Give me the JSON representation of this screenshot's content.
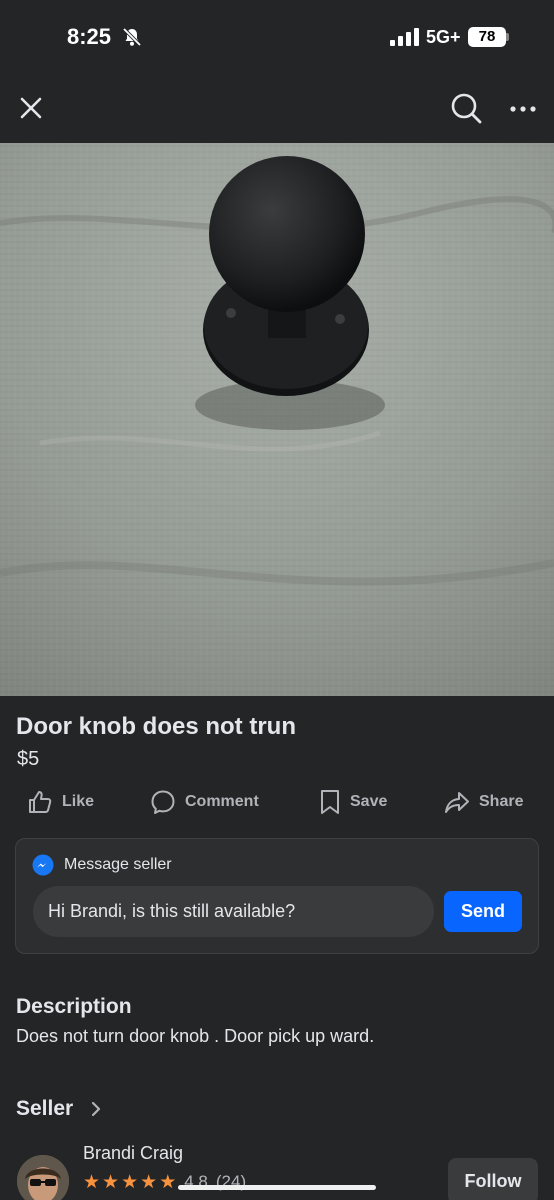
{
  "status_bar": {
    "time": "8:25",
    "network": "5G+",
    "battery": "78"
  },
  "nav": {
    "close_icon": "close-icon",
    "search_icon": "search-icon",
    "more_icon": "more-icon"
  },
  "listing": {
    "title": "Door knob does not trun",
    "price": "$5",
    "photo_subject": "black door knob on grey fabric"
  },
  "actions": {
    "like": "Like",
    "comment": "Comment",
    "save": "Save",
    "share": "Share"
  },
  "message": {
    "header": "Message seller",
    "input_value": "Hi Brandi, is this still available?",
    "send": "Send"
  },
  "description": {
    "heading": "Description",
    "text": "Does not turn door knob . Door pick up ward."
  },
  "seller": {
    "heading": "Seller",
    "name": "Brandi Craig",
    "rating": "4.8",
    "rating_count": "(24)",
    "star_count": 5,
    "follow": "Follow"
  },
  "colors": {
    "background": "#242526",
    "accent": "#0866ff",
    "star": "#f7923e"
  }
}
